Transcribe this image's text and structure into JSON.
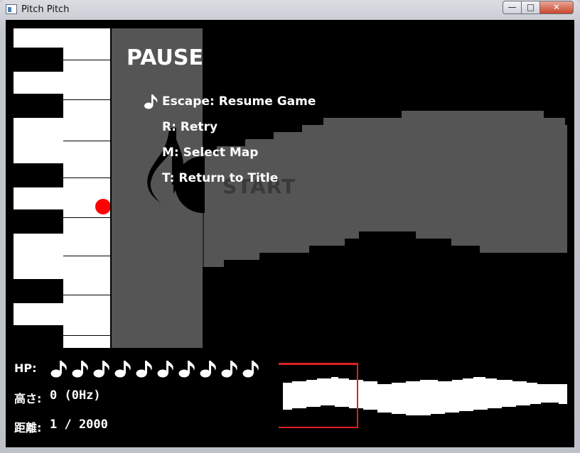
{
  "window": {
    "title": "Pitch Pitch",
    "minimize_icon": "minimize-icon",
    "maximize_icon": "maximize-icon",
    "close_icon": "close-icon"
  },
  "pause_menu": {
    "title": "PAUSE",
    "cursor_icon": "eighth-note-icon",
    "items": [
      {
        "label": "Escape: Resume Game"
      },
      {
        "label": "R: Retry"
      },
      {
        "label": "M: Select Map"
      },
      {
        "label": "T: Return to Title"
      }
    ]
  },
  "stage": {
    "start_label": "START",
    "start_marker_icon": "quarter-note-icon"
  },
  "hud": {
    "hp_label": "HP:",
    "hp_count": 10,
    "hp_icon": "eighth-note-icon",
    "pitch_label": "高さ:",
    "pitch_value": "0 (0Hz)",
    "distance_label": "距離:",
    "distance_value": "1 / 2000"
  },
  "colors": {
    "pitch_indicator": "#ff0000",
    "minimap_frame": "#e02020",
    "terrain": "#555555"
  }
}
